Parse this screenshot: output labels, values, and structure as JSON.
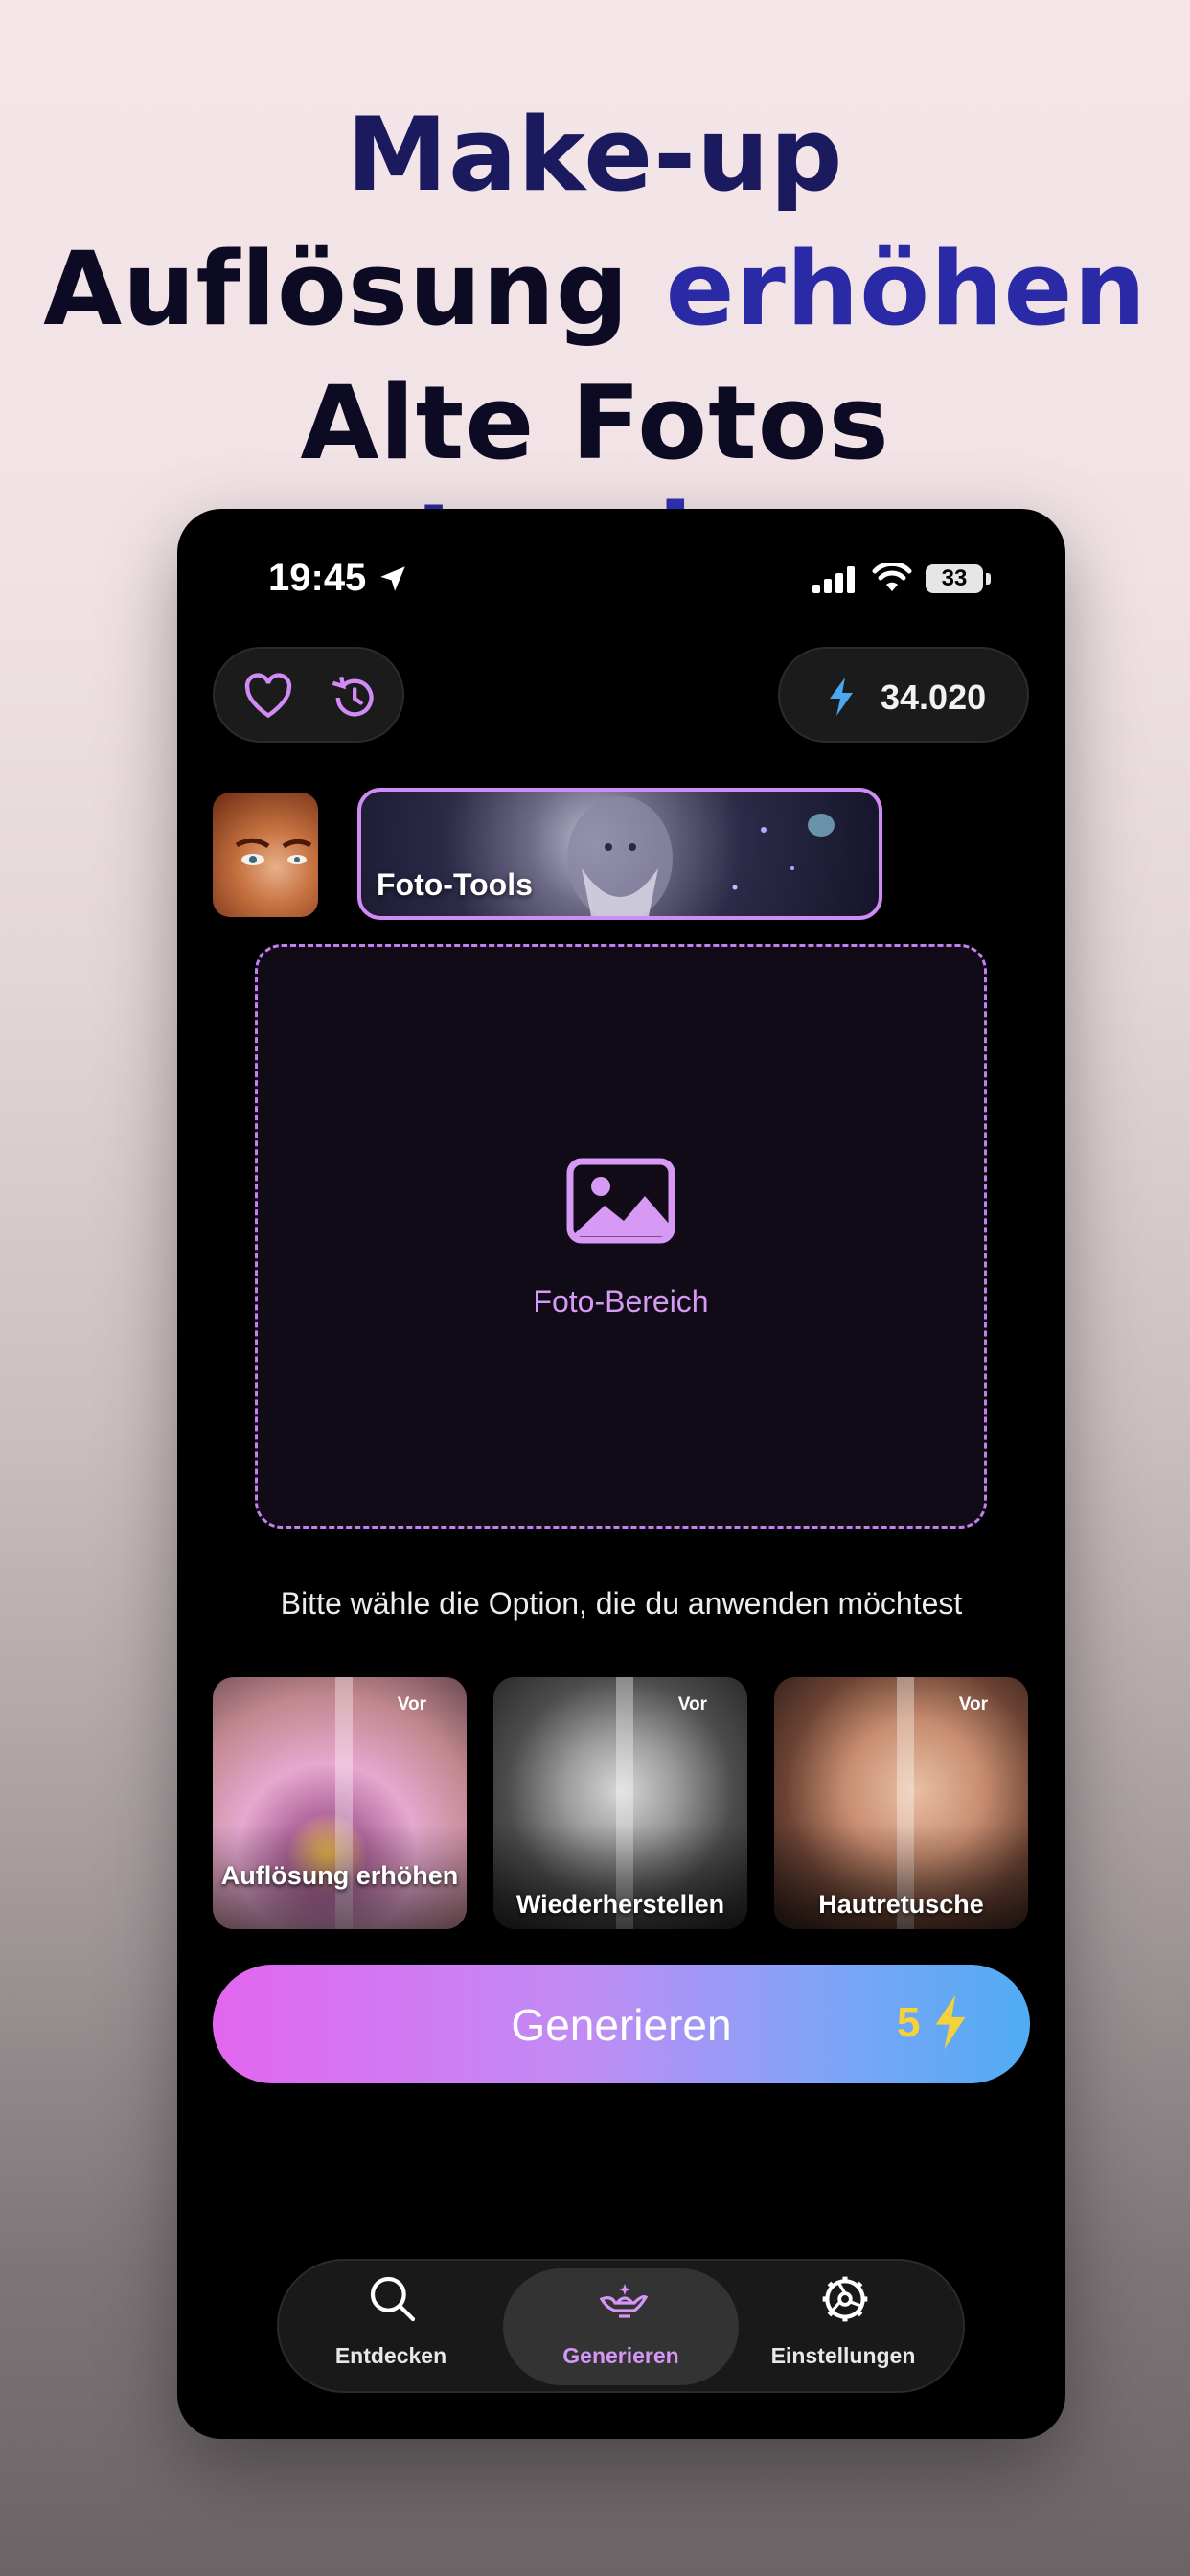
{
  "headline": {
    "line1": "Make-up",
    "line2_dark": "Auflösung",
    "line2_accent": "erhöhen",
    "line3_dark": "Alte Fotos",
    "line3_accent": "restaurieren"
  },
  "status_bar": {
    "time": "19:45",
    "battery": "33",
    "icons": [
      "location-arrow-icon",
      "cellular-signal-icon",
      "wifi-icon",
      "battery-icon"
    ]
  },
  "top_bar": {
    "left_icons": [
      "heart-icon",
      "history-icon"
    ],
    "credits": "34.020",
    "credits_icon": "bolt-icon"
  },
  "feature_carousel": {
    "active_label": "Foto-Tools"
  },
  "photo_area": {
    "label": "Foto-Bereich",
    "icon": "image-icon"
  },
  "prompt_text": "Bitte wähle die Option, die du anwenden möchtest",
  "options": [
    {
      "label": "Auflösung erhöhen",
      "badge": "Vor"
    },
    {
      "label": "Wiederherstellen",
      "badge": "Vor"
    },
    {
      "label": "Hautretusche",
      "badge": "Vor"
    }
  ],
  "generate": {
    "label": "Generieren",
    "cost": "5",
    "cost_icon": "bolt-icon"
  },
  "tabs": [
    {
      "label": "Entdecken",
      "icon": "search-icon"
    },
    {
      "label": "Generieren",
      "icon": "magic-lamp-icon",
      "active": true
    },
    {
      "label": "Einstellungen",
      "icon": "gear-icon"
    }
  ],
  "colors": {
    "accent_purple": "#d18bf4",
    "credit_bolt": "#4aa8f0",
    "cost_yellow": "#f5d13a"
  }
}
